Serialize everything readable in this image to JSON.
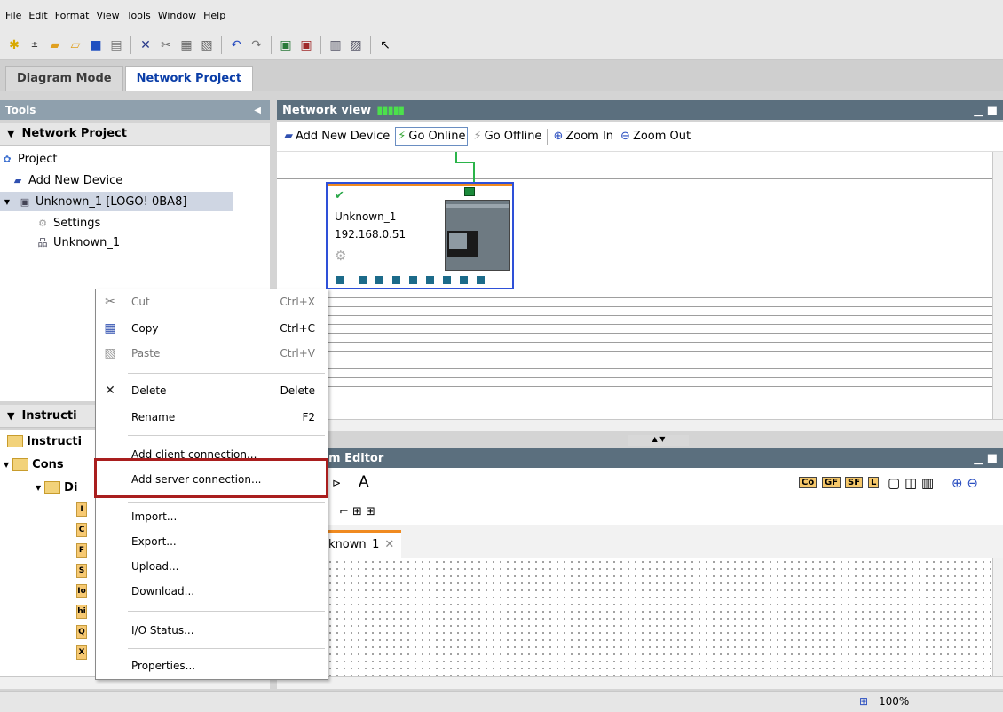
{
  "menu": [
    "File",
    "Edit",
    "Format",
    "View",
    "Tools",
    "Window",
    "Help"
  ],
  "mode_tabs": {
    "diagram": "Diagram Mode",
    "network": "Network Project"
  },
  "tools_panel": {
    "title": "Tools",
    "network_section": "Network Project",
    "tree": {
      "project": "Project",
      "add_new_device": "Add New Device",
      "device": "Unknown_1 [LOGO! 0BA8]",
      "settings": "Settings",
      "network": "Unknown_1"
    },
    "instructions_section": "Instructi",
    "instr_root": "Instructi",
    "instr_cons": "Cons",
    "instr_di": "Di",
    "instr_labels": [
      "I",
      "C",
      "F",
      "S",
      "Io",
      "hi",
      "Q",
      "X"
    ]
  },
  "network_view": {
    "title": "Network view",
    "toolbar": {
      "add_new_device": "Add New Device",
      "go_online": "Go Online",
      "go_offline": "Go Offline",
      "zoom_in": "Zoom In",
      "zoom_out": "Zoom Out"
    },
    "device": {
      "name": "Unknown_1",
      "ip": "192.168.0.51"
    }
  },
  "editor": {
    "title_partial": "m Editor",
    "tab_partial": "known_1",
    "toolbar_labels": [
      "A",
      "Co",
      "GF",
      "SF",
      "L"
    ]
  },
  "context_menu": {
    "cut": "Cut",
    "cut_short": "Ctrl+X",
    "copy": "Copy",
    "copy_short": "Ctrl+C",
    "paste": "Paste",
    "paste_short": "Ctrl+V",
    "delete": "Delete",
    "delete_short": "Delete",
    "rename": "Rename",
    "rename_short": "F2",
    "add_client": "Add client connection...",
    "add_server": "Add server connection...",
    "import": "Import...",
    "export": "Export...",
    "upload": "Upload...",
    "download": "Download...",
    "io_status": "I/O Status...",
    "properties": "Properties..."
  },
  "status": {
    "zoom": "100%"
  },
  "colors": {
    "highlight_box": "#a91e1e",
    "device_border": "#2e50d8",
    "accent_blue": "#0b3ea8"
  }
}
